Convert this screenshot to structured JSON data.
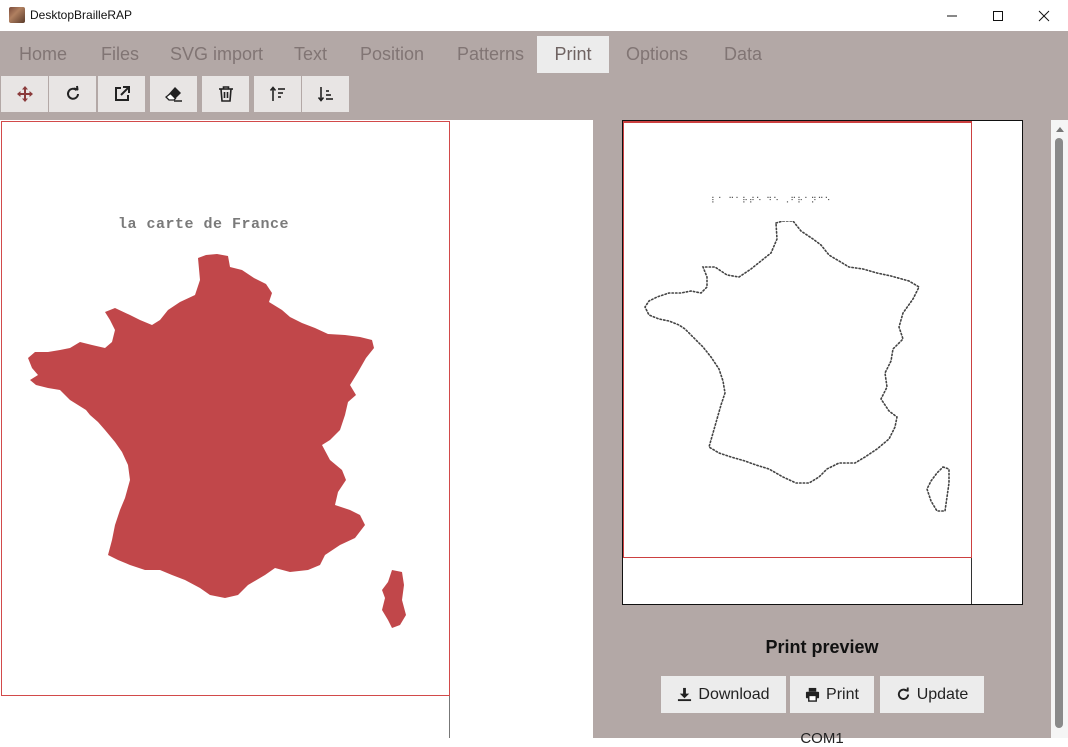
{
  "window": {
    "title": "DesktopBrailleRAP",
    "minimize_icon": "minimize-icon",
    "maximize_icon": "maximize-icon",
    "close_icon": "close-icon"
  },
  "tabs": [
    {
      "label": "Home",
      "active": false
    },
    {
      "label": "Files",
      "active": false
    },
    {
      "label": "SVG import",
      "active": false
    },
    {
      "label": "Text",
      "active": false
    },
    {
      "label": "Position",
      "active": false
    },
    {
      "label": "Patterns",
      "active": false
    },
    {
      "label": "Print",
      "active": true
    },
    {
      "label": "Options",
      "active": false
    },
    {
      "label": "Data",
      "active": false
    }
  ],
  "toolbar": {
    "icons": [
      "move-icon",
      "rotate-icon",
      "external-link-icon",
      "eraser-icon",
      "trash-icon",
      "sort-ascending-icon",
      "sort-descending-icon"
    ]
  },
  "canvas": {
    "map_title": "la carte de France"
  },
  "preview": {
    "braille_text": "⠇⠁ ⠉⠁⠗⠞⠑ ⠙⠑ ⠠⠋⠗⠁⠝⠉⠑",
    "label": "Print preview",
    "buttons": [
      {
        "label": "Download",
        "icon": "download-icon"
      },
      {
        "label": "Print",
        "icon": "printer-icon"
      },
      {
        "label": "Update",
        "icon": "refresh-icon"
      }
    ],
    "port": "COM1"
  },
  "colors": {
    "accent_map": "#c1474a",
    "chrome": "#b3a8a6",
    "page_border": "#d24a4a"
  }
}
